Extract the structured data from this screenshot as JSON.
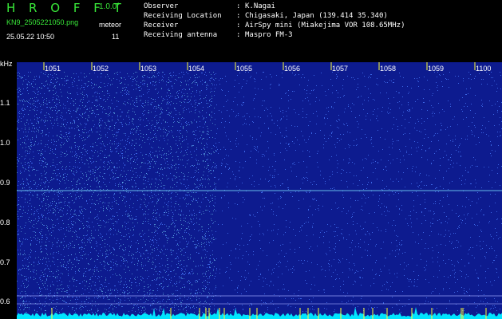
{
  "header": {
    "app_title": "H R O F F T",
    "version": "1.0.0f",
    "filename": "KN9_2505221050.png",
    "meteor_label": "meteor",
    "datetime": "25.05.22 10:50",
    "meteor_count": "11"
  },
  "info": [
    {
      "label": "Observer",
      "value": "K.Nagai"
    },
    {
      "label": "Receiving Location",
      "value": "Chigasaki, Japan (139.414 35.340)"
    },
    {
      "label": "Receiver",
      "value": "AirSpy mini (Miakejima VOR 108.65MHz)"
    },
    {
      "label": "Receiving antenna",
      "value": "Maspro FM-3"
    }
  ],
  "plot": {
    "y_unit": "kHz",
    "y_ticks": [
      "1.1",
      "1.0",
      "0.9",
      "0.8",
      "0.7",
      "0.6"
    ],
    "x_ticks": [
      "1051",
      "1052",
      "1053",
      "1054",
      "1055",
      "1056",
      "1057",
      "1058",
      "1059",
      "1100"
    ],
    "colors": {
      "background": "#0d1b8f",
      "noise": "#4a7dff",
      "signal": "#7fe7ff",
      "tick": "#ffff33",
      "baseline": "#00e5ff"
    }
  }
}
